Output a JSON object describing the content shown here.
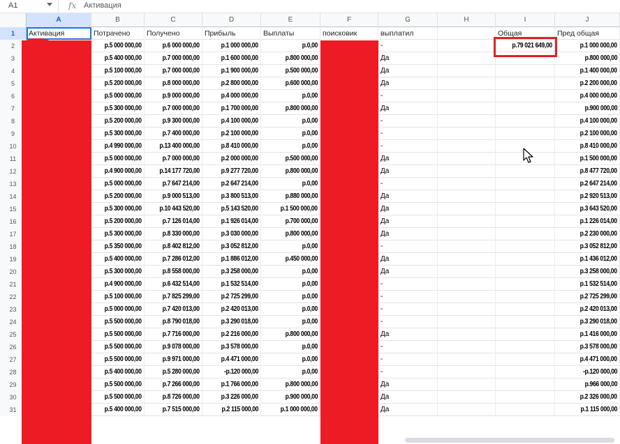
{
  "formula_bar": {
    "cell_ref": "A1",
    "fx": "fx",
    "content": "Активация"
  },
  "columns": [
    "A",
    "B",
    "C",
    "D",
    "E",
    "F",
    "G",
    "H",
    "I",
    "J"
  ],
  "headers": {
    "A": "Активация",
    "B": "Потрачено",
    "C": "Получено",
    "D": "Прибыль",
    "E": "Выплаты",
    "F": "поисковик",
    "G": "выплатил",
    "H": "",
    "I": "Общая",
    "J": "Пред общая"
  },
  "total_value": "р.79 021 649,00",
  "rows": [
    {
      "n": "2",
      "b": "р.5 000 000,00",
      "c": "р.6 000 000,00",
      "d": "р.1 000 000,00",
      "e": "р.0,00",
      "g": "-",
      "j": "р.1 000 000,00"
    },
    {
      "n": "3",
      "b": "р.5 400 000,00",
      "c": "р.7 000 000,00",
      "d": "р.1 600 000,00",
      "e": "р.800 000,00",
      "g": "Да",
      "j": "р.800 000,00"
    },
    {
      "n": "4",
      "b": "р.5 100 000,00",
      "c": "р.7 000 000,00",
      "d": "р.1 900 000,00",
      "e": "р.500 000,00",
      "g": "Да",
      "j": "р.1 400 000,00"
    },
    {
      "n": "5",
      "b": "р.5 200 000,00",
      "c": "р.8 000 000,00",
      "d": "р.2 800 000,00",
      "e": "р.600 000,00",
      "g": "Да",
      "j": "р.2 200 000,00"
    },
    {
      "n": "6",
      "b": "р.5 000 000,00",
      "c": "р.9 000 000,00",
      "d": "р.4 000 000,00",
      "e": "р.0,00",
      "g": "-",
      "j": "р.4 000 000,00"
    },
    {
      "n": "7",
      "b": "р.5 300 000,00",
      "c": "р.7 000 000,00",
      "d": "р.1 700 000,00",
      "e": "р.800 000,00",
      "g": "Да",
      "j": "р.900 000,00"
    },
    {
      "n": "8",
      "b": "р.5 200 000,00",
      "c": "р.9 300 000,00",
      "d": "р.4 100 000,00",
      "e": "р.0,00",
      "g": "-",
      "j": "р.4 100 000,00"
    },
    {
      "n": "9",
      "b": "р.5 300 000,00",
      "c": "р.7 400 000,00",
      "d": "р.2 100 000,00",
      "e": "р.0,00",
      "g": "-",
      "j": "р.2 100 000,00"
    },
    {
      "n": "10",
      "b": "р.4 990 000,00",
      "c": "р.13 400 000,00",
      "d": "р.8 410 000,00",
      "e": "р.0,00",
      "g": "-",
      "j": "р.8 410 000,00"
    },
    {
      "n": "11",
      "b": "р.5 000 000,00",
      "c": "р.7 000 000,00",
      "d": "р.2 000 000,00",
      "e": "р.500 000,00",
      "g": "Да",
      "j": "р.1 500 000,00"
    },
    {
      "n": "12",
      "b": "р.4 900 000,00",
      "c": "р.14 177 720,00",
      "d": "р.9 277 720,00",
      "e": "р.800 000,00",
      "g": "Да",
      "j": "р.8 477 720,00"
    },
    {
      "n": "13",
      "b": "р.5 000 000,00",
      "c": "р.7 647 214,00",
      "d": "р.2 647 214,00",
      "e": "р.0,00",
      "g": "-",
      "j": "р.2 647 214,00"
    },
    {
      "n": "14",
      "b": "р.5 200 000,00",
      "c": "р.9 000 513,00",
      "d": "р.3 800 513,00",
      "e": "р.880 000,00",
      "g": "Да",
      "j": "р.2 920 513,00"
    },
    {
      "n": "15",
      "b": "р.5 300 000,00",
      "c": "р.10 443 520,00",
      "d": "р.5 143 520,00",
      "e": "р.1 500 000,00",
      "g": "Да",
      "j": "р.3 643 520,00"
    },
    {
      "n": "16",
      "b": "р.5 200 000,00",
      "c": "р.7 126 014,00",
      "d": "р.1 926 014,00",
      "e": "р.700 000,00",
      "g": "Да",
      "j": "р.1 226 014,00"
    },
    {
      "n": "17",
      "b": "р.5 300 000,00",
      "c": "р.8 330 000,00",
      "d": "р.3 030 000,00",
      "e": "р.800 000,00",
      "g": "Да",
      "j": "р.2 230 000,00"
    },
    {
      "n": "18",
      "b": "р.5 350 000,00",
      "c": "р.8 402 812,00",
      "d": "р.3 052 812,00",
      "e": "р.0,00",
      "g": "-",
      "j": "р.3 052 812,00"
    },
    {
      "n": "19",
      "b": "р.5 400 000,00",
      "c": "р.7 286 012,00",
      "d": "р.1 886 012,00",
      "e": "р.450 000,00",
      "g": "Да",
      "j": "р.1 436 012,00"
    },
    {
      "n": "20",
      "b": "р.5 300 000,00",
      "c": "р.8 558 000,00",
      "d": "р.3 258 000,00",
      "e": "р.0,00",
      "g": "Да",
      "j": "р.3 258 000,00"
    },
    {
      "n": "21",
      "b": "р.4 900 000,00",
      "c": "р.6 432 514,00",
      "d": "р.1 532 514,00",
      "e": "р.0,00",
      "g": "-",
      "j": "р.1 532 514,00"
    },
    {
      "n": "22",
      "b": "р.5 100 000,00",
      "c": "р.7 825 299,00",
      "d": "р.2 725 299,00",
      "e": "р.0,00",
      "g": "-",
      "j": "р.2 725 299,00"
    },
    {
      "n": "23",
      "b": "р.5 000 000,00",
      "c": "р.7 420 013,00",
      "d": "р.2 420 013,00",
      "e": "р.0,00",
      "g": "-",
      "j": "р.2 420 013,00"
    },
    {
      "n": "24",
      "b": "р.5 500 000,00",
      "c": "р.8 790 018,00",
      "d": "р.3 290 018,00",
      "e": "р.0,00",
      "g": "-",
      "j": "р.3 290 018,00"
    },
    {
      "n": "25",
      "b": "р.5 500 000,00",
      "c": "р.7 716 000,00",
      "d": "р.2 216 000,00",
      "e": "р.800 000,00",
      "g": "Да",
      "j": "р.1 416 000,00"
    },
    {
      "n": "26",
      "b": "р.5 500 000,00",
      "c": "р.9 078 000,00",
      "d": "р.3 578 000,00",
      "e": "р.0,00",
      "g": "-",
      "j": "р.3 578 000,00"
    },
    {
      "n": "27",
      "b": "р.5 500 000,00",
      "c": "р.9 971 000,00",
      "d": "р.4 471 000,00",
      "e": "р.0,00",
      "g": "-",
      "j": "р.4 471 000,00"
    },
    {
      "n": "28",
      "b": "р.5 400 000,00",
      "c": "р.5 280 000,00",
      "d": "-р.120 000,00",
      "e": "р.0,00",
      "g": "-",
      "j": "-р.120 000,00"
    },
    {
      "n": "29",
      "b": "р.5 500 000,00",
      "c": "р.7 266 000,00",
      "d": "р.1 766 000,00",
      "e": "р.800 000,00",
      "g": "Да",
      "j": "р.966 000,00"
    },
    {
      "n": "30",
      "b": "р.5 500 000,00",
      "c": "р.8 726 000,00",
      "d": "р.3 226 000,00",
      "e": "р.900 000,00",
      "g": "Да",
      "j": "р.2 326 000,00"
    },
    {
      "n": "31",
      "b": "р.5 400 000,00",
      "c": "р.7 515 000,00",
      "d": "р.2 115 000,00",
      "e": "р.1 000 000,00",
      "g": "Да",
      "j": "р.1 115 000,00"
    }
  ]
}
